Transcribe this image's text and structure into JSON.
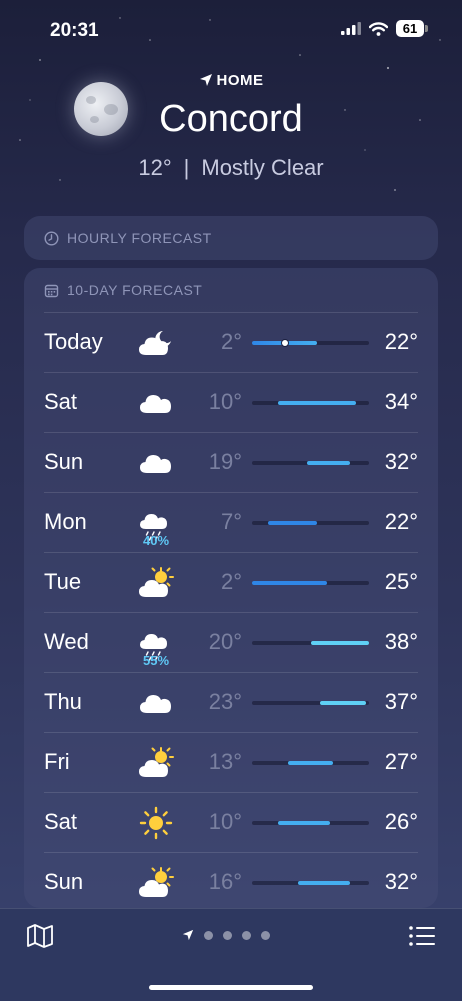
{
  "status": {
    "time": "20:31",
    "battery": "61"
  },
  "location": {
    "label": "HOME",
    "city": "Concord",
    "temp": "12°",
    "separator": "|",
    "condition": "Mostly Clear"
  },
  "hourly": {
    "title": "HOURLY FORECAST"
  },
  "daily": {
    "title": "10-DAY FORECAST",
    "range_min": 2,
    "range_max": 38,
    "bar_colors": [
      "#2f86e6",
      "#44aef0",
      "#5fd0f5"
    ],
    "days": [
      {
        "day": "Today",
        "icon": "cloudy-night-icon",
        "precip": "",
        "low": "2°",
        "high": "22°",
        "low_val": 2,
        "high_val": 22,
        "current": 12
      },
      {
        "day": "Sat",
        "icon": "cloud-icon",
        "precip": "",
        "low": "10°",
        "high": "34°",
        "low_val": 10,
        "high_val": 34
      },
      {
        "day": "Sun",
        "icon": "cloud-icon",
        "precip": "",
        "low": "19°",
        "high": "32°",
        "low_val": 19,
        "high_val": 32
      },
      {
        "day": "Mon",
        "icon": "rain-cloud-icon",
        "precip": "40%",
        "low": "7°",
        "high": "22°",
        "low_val": 7,
        "high_val": 22
      },
      {
        "day": "Tue",
        "icon": "partly-sunny-icon",
        "precip": "",
        "low": "2°",
        "high": "25°",
        "low_val": 2,
        "high_val": 25
      },
      {
        "day": "Wed",
        "icon": "rain-cloud-icon",
        "precip": "55%",
        "low": "20°",
        "high": "38°",
        "low_val": 20,
        "high_val": 38
      },
      {
        "day": "Thu",
        "icon": "cloud-icon",
        "precip": "",
        "low": "23°",
        "high": "37°",
        "low_val": 23,
        "high_val": 37
      },
      {
        "day": "Fri",
        "icon": "partly-sunny-icon",
        "precip": "",
        "low": "13°",
        "high": "27°",
        "low_val": 13,
        "high_val": 27
      },
      {
        "day": "Sat",
        "icon": "sun-icon",
        "precip": "",
        "low": "10°",
        "high": "26°",
        "low_val": 10,
        "high_val": 26
      },
      {
        "day": "Sun",
        "icon": "partly-sunny-icon",
        "precip": "",
        "low": "16°",
        "high": "32°",
        "low_val": 16,
        "high_val": 32
      }
    ]
  },
  "bottom": {
    "map_icon": "map-icon",
    "list_icon": "list-icon",
    "page_count": 5,
    "current_page": 0
  }
}
